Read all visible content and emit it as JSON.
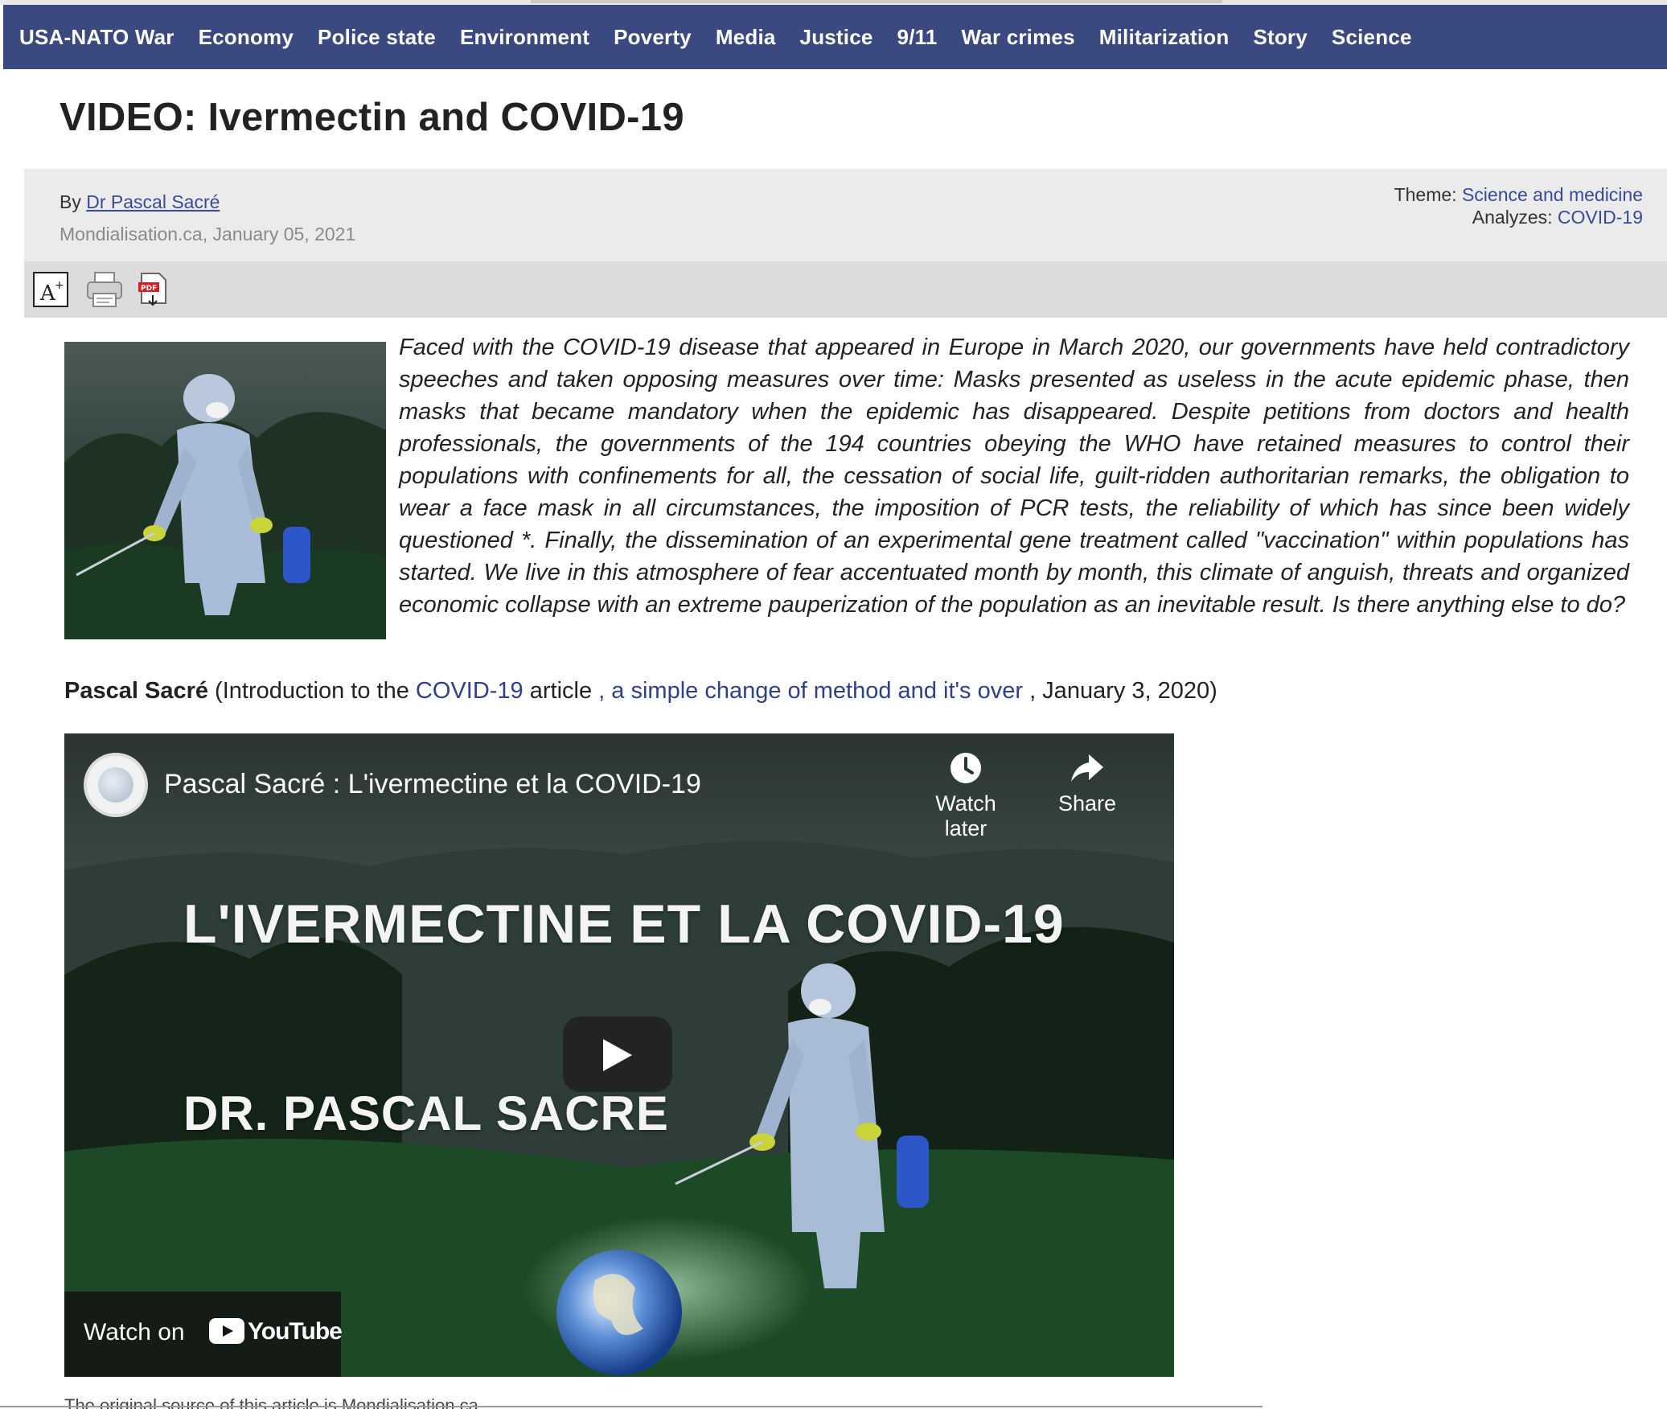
{
  "nav": {
    "items": [
      "USA-NATO War",
      "Economy",
      "Police state",
      "Environment",
      "Poverty",
      "Media",
      "Justice",
      "9/11",
      "War crimes",
      "Militarization",
      "Story",
      "Science"
    ]
  },
  "article": {
    "title": "VIDEO: Ivermectin and COVID-19",
    "by_label": "By",
    "author": "Dr Pascal Sacré",
    "source_date": "Mondialisation.ca, January 05, 2021",
    "theme_label": "Theme:",
    "theme_value": "Science and medicine",
    "analyzes_label": "Analyzes:",
    "analyzes_value": "COVID-19",
    "intro": "Faced with the COVID-19 disease that appeared in Europe in March 2020, our governments have held contradictory speeches and taken opposing measures over time: Masks presented as useless in the acute epidemic phase, then masks that became mandatory when the epidemic has disappeared. Despite petitions from doctors and health professionals, the governments of the 194 countries obeying the WHO have retained measures to control their populations with confinements for all, the cessation of social life, guilt-ridden authoritarian remarks, the obligation to wear a face mask in all circumstances, the imposition of PCR tests, the reliability of which has since been widely questioned *. Finally, the dissemination of an experimental gene treatment called \"vaccination\" within populations has started. We live in this atmosphere of fear accentuated month by month, this climate of anguish, threats and organized economic collapse with an extreme pauperization of the population as an inevitable result. Is there anything else to do?"
  },
  "caption": {
    "author": "Pascal Sacré",
    "prefix": " (Introduction to the ",
    "link1": "COVID-19",
    "middle": " article  ",
    "link2": ", a simple change of method and it's over",
    "suffix": " , January 3, 2020)"
  },
  "video": {
    "title": "Pascal Sacré : L'ivermectine et la COVID-19",
    "watch_later": "Watch later",
    "share": "Share",
    "headline": "L'IVERMECTINE ET LA COVID-19",
    "author_overlay": "DR. PASCAL SACRE",
    "watch_on": "Watch on",
    "youtube": "YouTube"
  },
  "footer": {
    "partial_text": "The original source of this article is Mondialisation.ca"
  },
  "colors": {
    "nav_bg": "#3a4a80",
    "link": "#3a4a9a",
    "meta_bg": "#ebebeb",
    "toolbar_bg": "#dcdcdc"
  }
}
